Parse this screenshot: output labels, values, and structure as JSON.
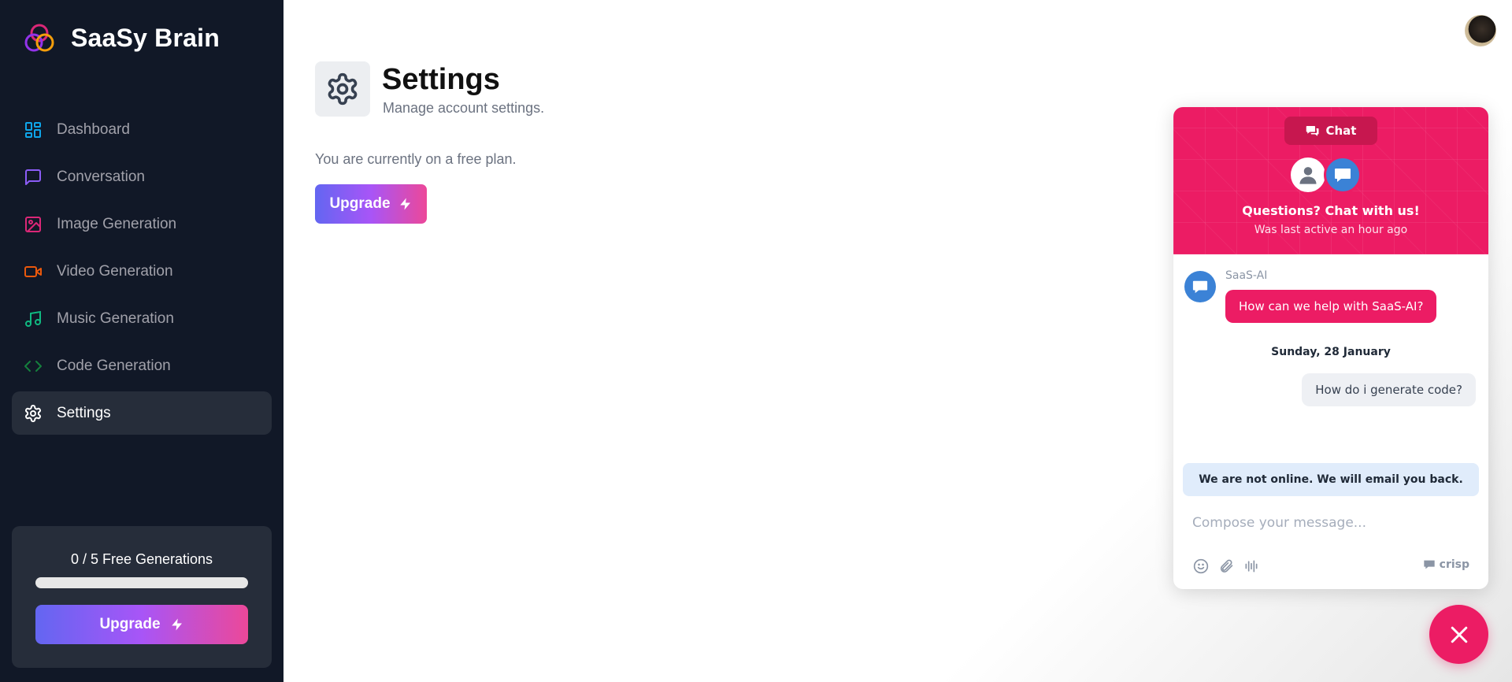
{
  "app": {
    "name": "SaaSy Brain"
  },
  "sidebar": {
    "items": [
      {
        "label": "Dashboard",
        "icon": "layout-dashboard-icon",
        "color": "#0ea5e9"
      },
      {
        "label": "Conversation",
        "icon": "message-square-icon",
        "color": "#8b5cf6"
      },
      {
        "label": "Image Generation",
        "icon": "image-icon",
        "color": "#db2777"
      },
      {
        "label": "Video Generation",
        "icon": "video-icon",
        "color": "#ea580c"
      },
      {
        "label": "Music Generation",
        "icon": "music-icon",
        "color": "#10b981"
      },
      {
        "label": "Code Generation",
        "icon": "code-icon",
        "color": "#15803d"
      },
      {
        "label": "Settings",
        "icon": "settings-icon",
        "color": "#ffffff",
        "active": true
      }
    ],
    "free_card": {
      "text": "0 / 5 Free Generations",
      "used": 0,
      "limit": 5,
      "upgrade_label": "Upgrade"
    }
  },
  "page": {
    "title": "Settings",
    "subtitle": "Manage account settings.",
    "plan_text": "You are currently on a free plan.",
    "upgrade_label": "Upgrade"
  },
  "chat": {
    "tab_label": "Chat",
    "header_title": "Questions? Chat with us!",
    "header_subtitle": "Was last active an hour ago",
    "bot_name": "SaaS-AI",
    "bot_message": "How can we help with SaaS-AI?",
    "date": "Sunday, 28 January",
    "user_message": "How do i generate code?",
    "offline_notice": "We are not online. We will email you back.",
    "compose_placeholder": "Compose your message...",
    "brand": "crisp",
    "accent": "#ec1c64"
  }
}
